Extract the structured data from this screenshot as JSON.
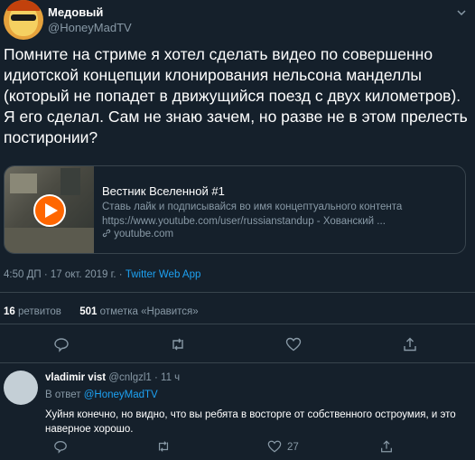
{
  "tweet": {
    "author_name": "Медовый",
    "author_handle": "@HoneyMadTV",
    "text": "Помните на стриме я хотел сделать видео по совершенно идиотской концепции клонирования нельсона манделлы (который не попадет в движущийся поезд с двух километров). Я его сделал. Сам не знаю зачем, но разве не в этом прелесть постиронии?",
    "card": {
      "title": "Вестник Вселенной #1",
      "description_line1": "Ставь лайк и подписывайся во имя концептуального контента",
      "description_line2": "https://www.youtube.com/user/russianstandup - Хованский ...",
      "domain": "youtube.com"
    },
    "time": "4:50 ДП",
    "date": "17 окт. 2019 г.",
    "separator": "·",
    "app": "Twitter Web App",
    "retweets_count": "16",
    "retweets_label": "ретвитов",
    "likes_count": "501",
    "likes_label": "отметка «Нравится»"
  },
  "reply": {
    "author_name": "vladimir vist",
    "author_handle": "@cnlgzl1",
    "time": "· 11 ч",
    "reply_to_label": "В ответ",
    "reply_to_handle": "@HoneyMadTV",
    "text": "Хуйня конечно, но видно, что вы ребята в восторге от собственного остроумия, и это наверное хорошо.",
    "likes_count": "27"
  },
  "colors": {
    "background": "#15202b",
    "border": "#38444d",
    "muted": "#8899a6",
    "accent": "#1da1f2",
    "youtube_play": "#ff6600"
  },
  "icons": [
    "chevron-down-icon",
    "play-icon",
    "link-icon",
    "reply-icon",
    "retweet-icon",
    "like-icon",
    "share-icon"
  ]
}
